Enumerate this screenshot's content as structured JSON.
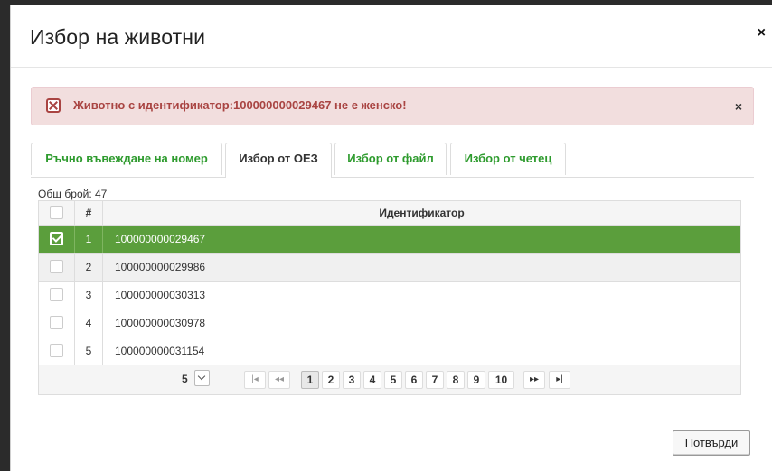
{
  "modal": {
    "title": "Избор на животни",
    "close": "×"
  },
  "alert": {
    "message": "Животно с идентификатор:100000000029467 не е женско!",
    "close": "×"
  },
  "tabs": [
    {
      "label": "Ръчно въвеждане на номер",
      "active": false
    },
    {
      "label": "Избор от ОЕЗ",
      "active": true
    },
    {
      "label": "Избор от файл",
      "active": false
    },
    {
      "label": "Избор от четец",
      "active": false
    }
  ],
  "grid": {
    "total_label": "Общ брой: 47",
    "columns": {
      "num": "#",
      "id": "Идентификатор"
    },
    "rows": [
      {
        "num": "1",
        "id": "100000000029467",
        "selected": true
      },
      {
        "num": "2",
        "id": "100000000029986",
        "selected": false
      },
      {
        "num": "3",
        "id": "100000000030313",
        "selected": false
      },
      {
        "num": "4",
        "id": "100000000030978",
        "selected": false
      },
      {
        "num": "5",
        "id": "100000000031154",
        "selected": false
      }
    ]
  },
  "pager": {
    "page_size": "5",
    "first": "|◂",
    "prev": "◂◂",
    "pages": [
      "1",
      "2",
      "3",
      "4",
      "5",
      "6",
      "7",
      "8",
      "9",
      "10"
    ],
    "current_page": "1",
    "next": "▸▸",
    "last": "▸|"
  },
  "footer": {
    "confirm_label": "Потвърди"
  },
  "colors": {
    "selected_row": "#5b9e3c",
    "tab_text": "#2e9b2e",
    "alert_bg": "#f2dede",
    "alert_text": "#a94442"
  }
}
